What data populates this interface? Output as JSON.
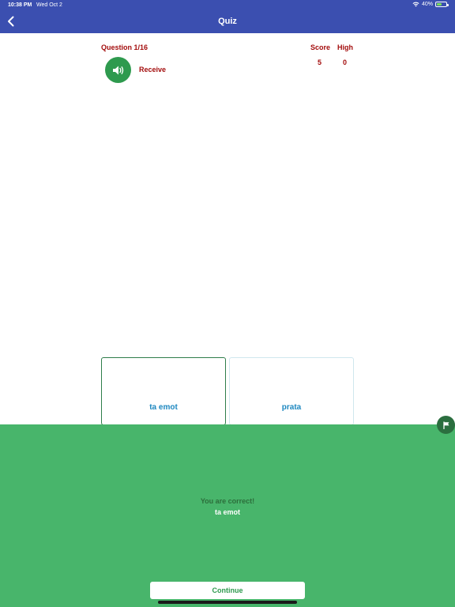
{
  "status_bar": {
    "time": "10:38 PM",
    "date": "Wed Oct 2",
    "battery": "40%"
  },
  "nav": {
    "title": "Quiz"
  },
  "quiz": {
    "question_label": "Question 1/16",
    "score_label": "Score",
    "high_label": "High",
    "score_value": "5",
    "high_value": "0",
    "word": "Receive",
    "options": [
      "ta emot",
      "prata"
    ]
  },
  "result": {
    "message": "You are correct!",
    "answer": "ta emot",
    "continue_label": "Continue"
  },
  "colors": {
    "header": "#3b4fb0",
    "accent_red": "#a30d0d",
    "success": "#48b56b",
    "option_text": "#1e88c0"
  },
  "icons": [
    "back-chevron-icon",
    "wifi-icon",
    "battery-icon",
    "speaker-icon",
    "flag-icon"
  ]
}
